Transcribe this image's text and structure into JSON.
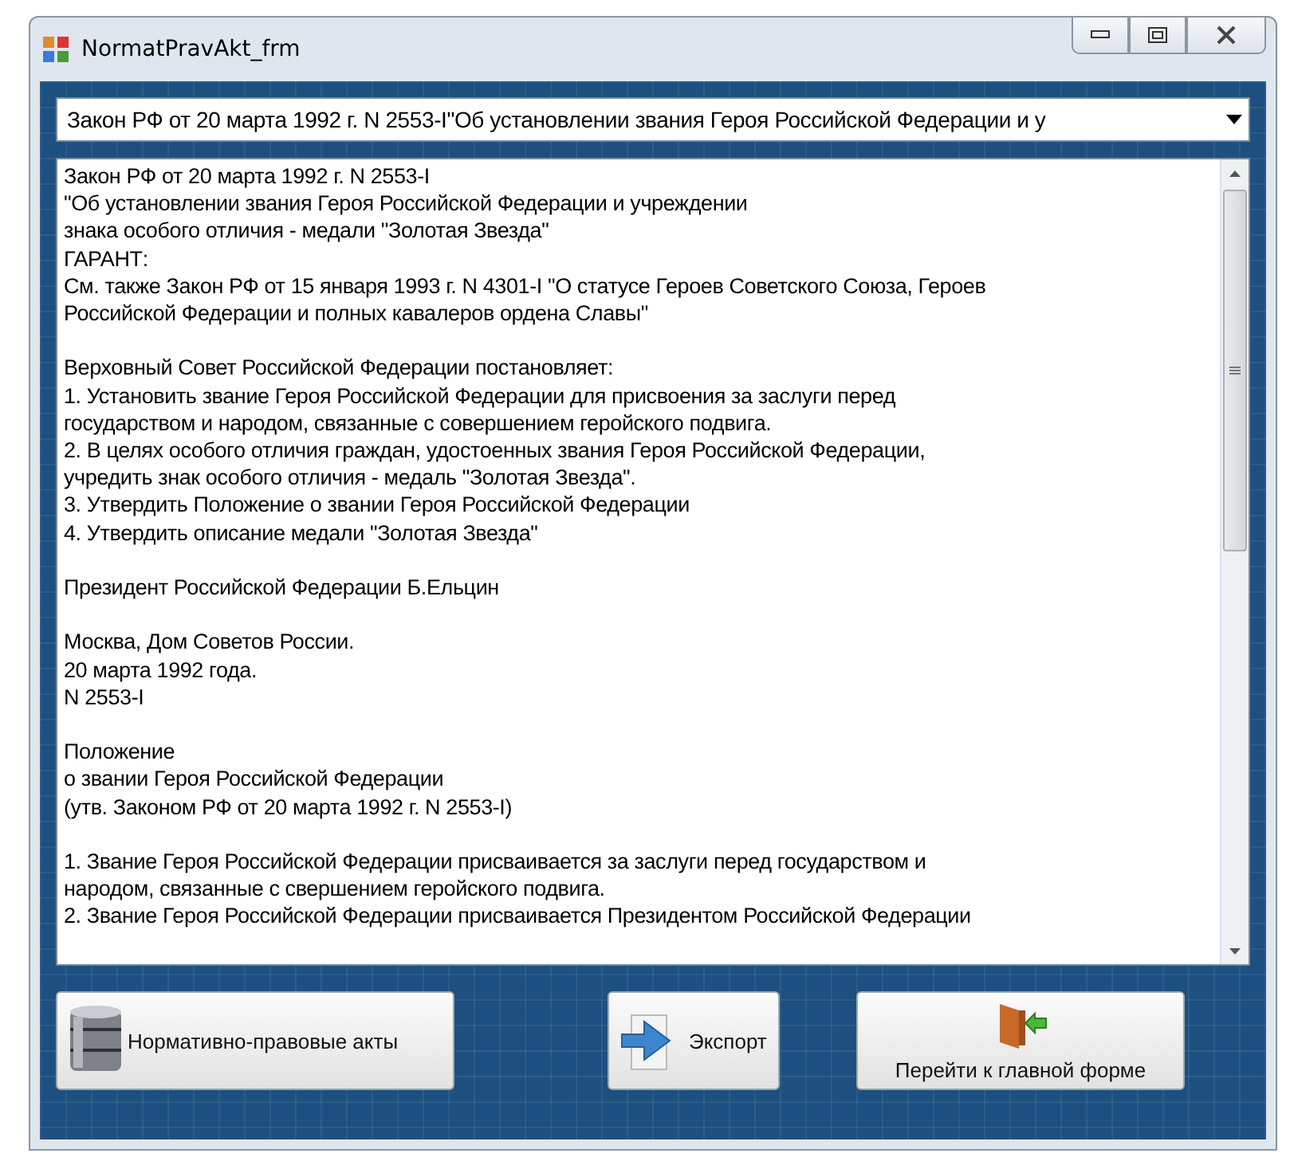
{
  "window": {
    "title": "NormatPravAkt_frm"
  },
  "combo": {
    "value": "Закон РФ от 20 марта 1992 г. N 2553-I\"Об установлении звания Героя Российской Федерации и у"
  },
  "document": {
    "paragraphs": [
      {
        "lines": [
          "Закон РФ от 20 марта 1992 г. N 2553-I",
          "\"Об установлении звания Героя Российской Федерации и учреждении",
          "знака особого отличия - медали \"Золотая Звезда\"",
          "ГАРАНТ:",
          "См. также Закон РФ от 15 января 1993 г. N 4301-I \"О статусе Героев Советского Союза, Героев",
          "Российской Федерации и полных кавалеров ордена Славы\""
        ]
      },
      {
        "lines": [
          "Верховный Совет Российской Федерации постановляет:",
          "1. Установить звание Героя Российской Федерации для присвоения за заслуги перед",
          "государством и народом, связанные с совершением геройского подвига.",
          "2. В целях особого отличия граждан, удостоенных звания Героя Российской Федерации,",
          "учредить знак особого отличия - медаль \"Золотая Звезда\".",
          "3. Утвердить Положение о звании Героя Российской Федерации",
          "4. Утвердить описание медали \"Золотая Звезда\""
        ]
      },
      {
        "lines": [
          "Президент Российской Федерации    Б.Ельцин"
        ]
      },
      {
        "lines": [
          "Москва, Дом Советов России.",
          "20 марта 1992 года.",
          "N 2553-I"
        ]
      },
      {
        "lines": [
          "Положение",
          "о звании Героя Российской Федерации",
          "(утв. Законом РФ от 20 марта 1992 г. N 2553-I)"
        ]
      },
      {
        "lines": [
          "1. Звание Героя Российской Федерации присваивается за заслуги перед государством и",
          "народом, связанные с свершением геройского подвига.",
          "2. Звание Героя Российской Федерации присваивается Президентом Российской Федерации"
        ]
      }
    ]
  },
  "buttons": [
    {
      "kind": "database",
      "label": "Нормативно-правовые акты"
    },
    {
      "kind": "export",
      "label": "Экспорт"
    },
    {
      "kind": "exit",
      "label": "Перейти к главной форме"
    }
  ]
}
